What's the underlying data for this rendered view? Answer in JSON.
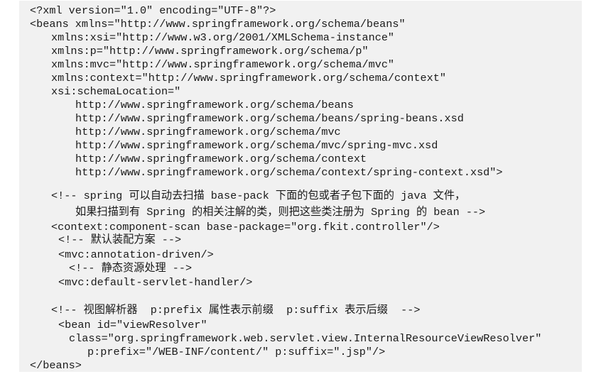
{
  "code": {
    "lines": [
      "<?xml version=\"1.0\" encoding=\"UTF-8\"?>",
      "<beans xmlns=\"http://www.springframework.org/schema/beans\"",
      "xmlns:xsi=\"http://www.w3.org/2001/XMLSchema-instance\"",
      "xmlns:p=\"http://www.springframework.org/schema/p\"",
      "xmlns:mvc=\"http://www.springframework.org/schema/mvc\"",
      "xmlns:context=\"http://www.springframework.org/schema/context\"",
      "xsi:schemaLocation=\"",
      "http://www.springframework.org/schema/beans",
      "http://www.springframework.org/schema/beans/spring-beans.xsd",
      "http://www.springframework.org/schema/mvc",
      "http://www.springframework.org/schema/mvc/spring-mvc.xsd",
      "http://www.springframework.org/schema/context",
      "http://www.springframework.org/schema/context/spring-context.xsd\">",
      "<!-- spring 可以自动去扫描 base-pack 下面的包或者子包下面的 java 文件，",
      "如果扫描到有 Spring 的相关注解的类，则把这些类注册为 Spring 的 bean -->",
      "<context:component-scan base-package=\"org.fkit.controller\"/>",
      "<!-- 默认装配方案 -->",
      "<mvc:annotation-driven/>",
      "<!-- 静态资源处理 -->",
      "<mvc:default-servlet-handler/>",
      "<!-- 视图解析器  p:prefix 属性表示前缀  p:suffix 表示后缀  -->",
      "<bean id=\"viewResolver\"",
      "class=\"org.springframework.web.servlet.view.InternalResourceViewResolver\"",
      "p:prefix=\"/WEB-INF/content/\" p:suffix=\".jsp\"/>",
      "</beans>"
    ]
  }
}
